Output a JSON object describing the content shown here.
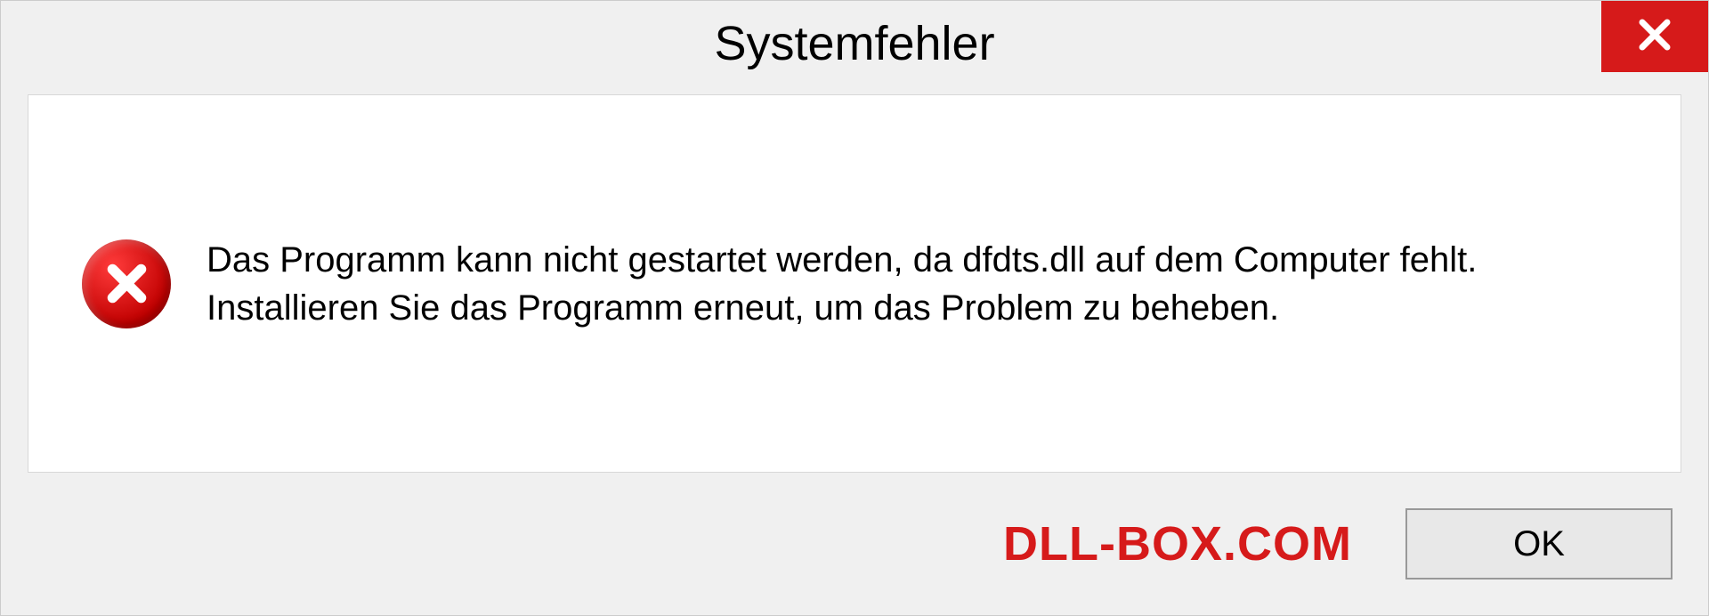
{
  "dialog": {
    "title": "Systemfehler",
    "message": "Das Programm kann nicht gestartet werden, da dfdts.dll auf dem Computer fehlt. Installieren Sie das Programm erneut, um das Problem zu beheben.",
    "ok_label": "OK"
  },
  "watermark": "DLL-BOX.COM"
}
